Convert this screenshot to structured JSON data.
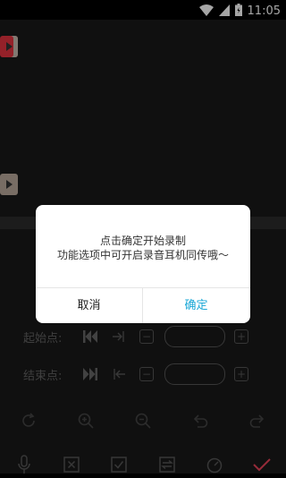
{
  "status_bar": {
    "time": "11:05"
  },
  "editor": {
    "start_label": "起始点:",
    "end_label": "结束点:",
    "start_value": "",
    "end_value": ""
  },
  "dialog": {
    "line1": "点击确定开始录制",
    "line2": "功能选项中可开启录音耳机同传哦〜",
    "cancel": "取消",
    "confirm": "确定"
  },
  "colors": {
    "accent": "#19a7d6",
    "marker": "#e4343f",
    "check": "#e84258"
  }
}
